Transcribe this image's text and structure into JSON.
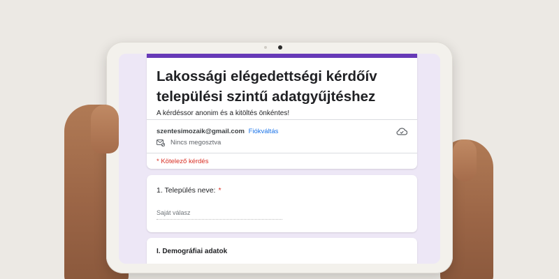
{
  "form": {
    "title": "Lakossági elégedettségi kérdőív települési szintű adatgyűjtéshez",
    "description": "A kérdéssor anonim és a kitöltés önkéntes!",
    "accent_color": "#673ab7",
    "account": {
      "email": "szentesimozaik@gmail.com",
      "switch_label": "Fiókváltás",
      "share_status": "Nincs megosztva"
    },
    "required_note": "* Kötelező kérdés",
    "questions": [
      {
        "label": "1. Település neve:",
        "required_mark": "*",
        "placeholder": "Saját válasz"
      }
    ],
    "sections": [
      {
        "title": "I. Demográfiai adatok"
      }
    ]
  },
  "icons": {
    "cloud": "cloud-save-icon",
    "share": "not-shared-icon",
    "camera": "camera-icon"
  }
}
